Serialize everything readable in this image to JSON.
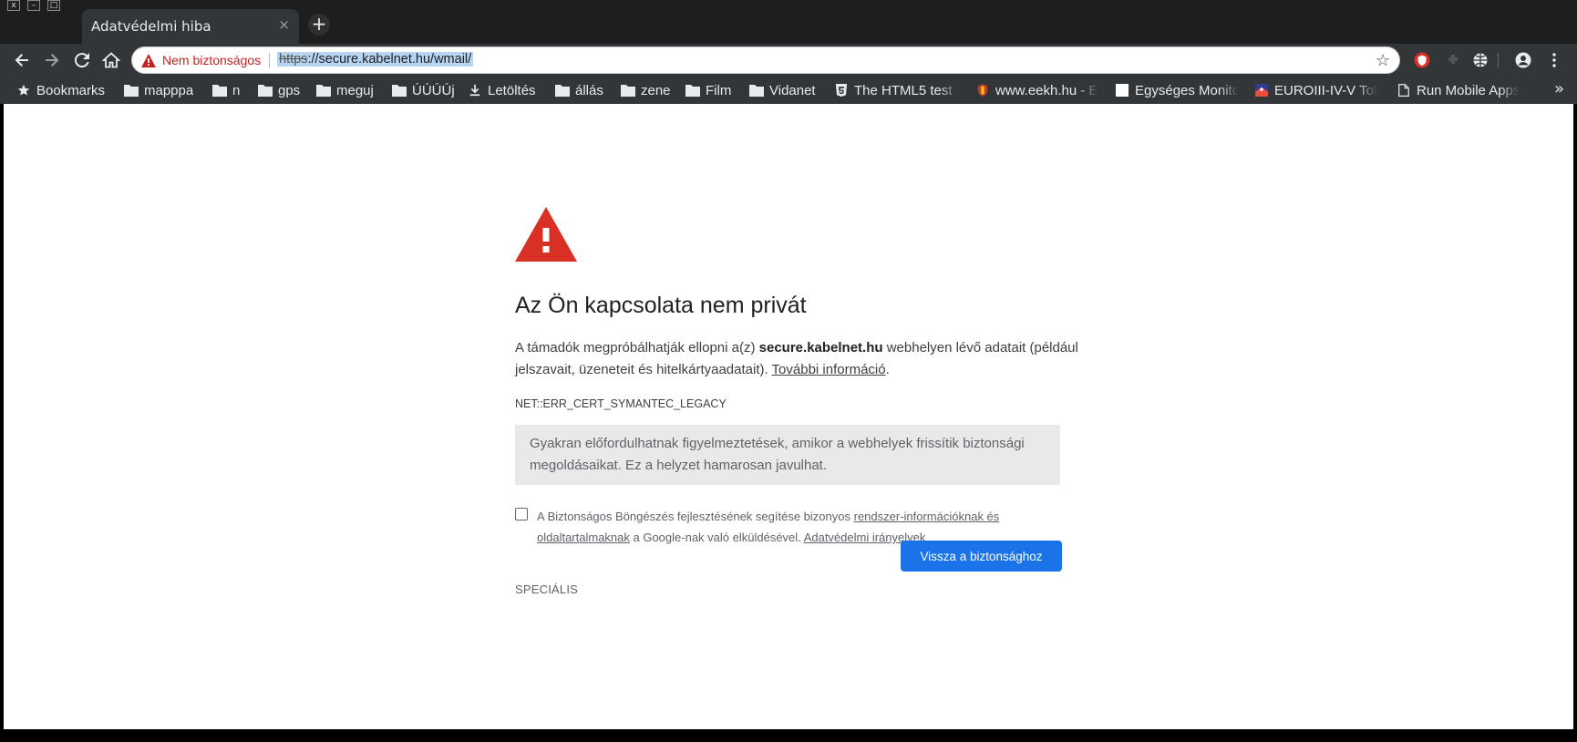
{
  "window": {
    "controls": [
      "x",
      "–",
      "□"
    ]
  },
  "tab": {
    "title": "Adatvédelmi hiba",
    "close": "×",
    "new_tab": "+"
  },
  "omnibox": {
    "security_label": "Nem biztonságos",
    "url_scheme": "https",
    "url_rest": "://secure.kabelnet.hu/wmail/",
    "bookmark_star": "☆"
  },
  "icons": {
    "back": "arrow-left-icon",
    "forward": "arrow-right-icon",
    "reload": "reload-icon",
    "home": "home-icon",
    "warning": "warning-triangle-icon",
    "extension_1": "shield-extension-icon",
    "extension_2": "puzzle-extension-icon",
    "extension_3": "globe-extension-icon",
    "account": "account-icon",
    "menu": "kebab-menu-icon"
  },
  "bookmarks": {
    "items": [
      {
        "label": "Bookmarks",
        "icon": "star-icon"
      },
      {
        "label": "mapppa",
        "icon": "folder-icon"
      },
      {
        "label": "n",
        "icon": "folder-icon"
      },
      {
        "label": "gps",
        "icon": "folder-icon"
      },
      {
        "label": "meguj",
        "icon": "folder-icon"
      },
      {
        "label": "ÚÚÚÚj",
        "icon": "folder-icon"
      },
      {
        "label": "Letöltés",
        "icon": "download-icon"
      },
      {
        "label": "állás",
        "icon": "folder-icon"
      },
      {
        "label": "zene",
        "icon": "folder-icon"
      },
      {
        "label": "Film",
        "icon": "folder-icon"
      },
      {
        "label": "Vidanet",
        "icon": "folder-icon"
      },
      {
        "label": "The HTML5 test -",
        "icon": "html5-icon"
      },
      {
        "label": "www.eekh.hu - E",
        "icon": "crest-icon"
      },
      {
        "label": "Egységes Monito",
        "icon": "blank-page-icon"
      },
      {
        "label": "EUROIII-IV-V Tot",
        "icon": "flag-icon"
      },
      {
        "label": "Run Mobile Apps",
        "icon": "document-icon"
      }
    ],
    "overflow": "»"
  },
  "interstitial": {
    "heading": "Az Ön kapcsolata nem privát",
    "para_start": "A támadók megpróbálhatják ellopni a(z) ",
    "para_host": "secure.kabelnet.hu",
    "para_end": " webhelyen lévő adatait (például jelszavait, üzeneteit és hitelkártyaadatait). ",
    "more_info_link": "További információ",
    "period": ".",
    "error_code": "NET::ERR_CERT_SYMANTEC_LEGACY",
    "notice": "Gyakran előfordulhatnak figyelmeztetések, amikor a webhelyek frissítik biztonsági megoldásaikat. Ez a helyzet hamarosan javulhat.",
    "optin_start": "A Biztonságos Böngészés fejlesztésének segítése bizonyos ",
    "optin_link1": "rendszer-információknak és oldaltartalmaknak",
    "optin_mid": " a Google-nak való elküldésével. ",
    "optin_link2": "Adatvédelmi irányelvek",
    "advanced_label": "SPECIÁLIS",
    "back_button": "Vissza a biztonsághoz"
  },
  "colors": {
    "warning_red": "#d93025",
    "primary_blue": "#1a73e8",
    "notice_bg": "#e9e9e9"
  }
}
